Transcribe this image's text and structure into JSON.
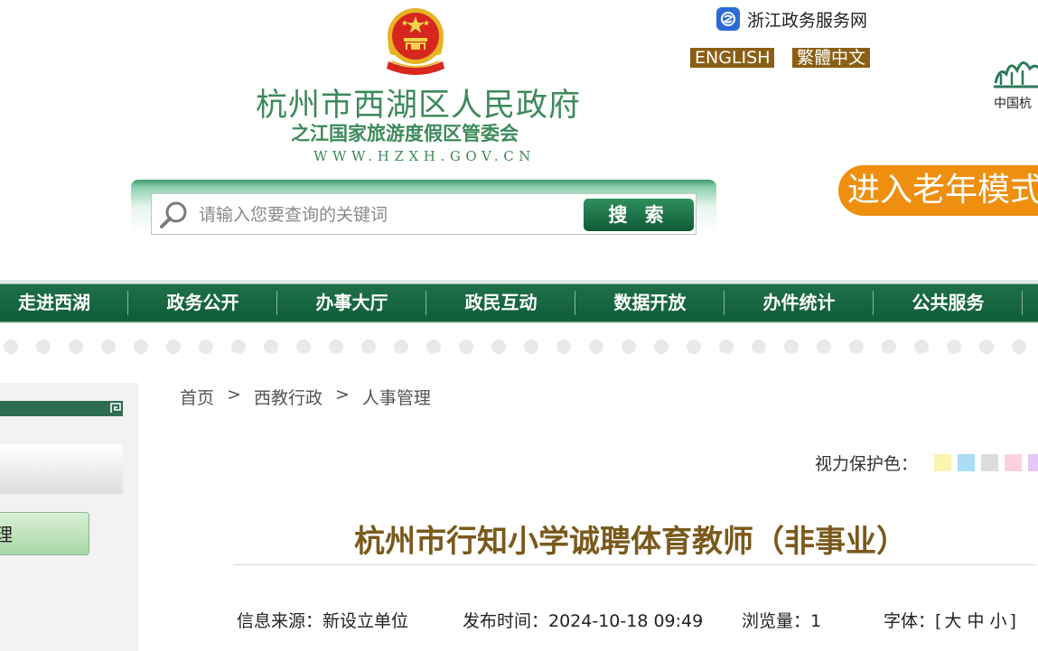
{
  "header": {
    "site_title": "杭州市西湖区人民政府",
    "site_subtitle": "之江国家旅游度假区管委会",
    "site_url": "WWW.HZXH.GOV.CN",
    "zj_service_label": "浙江政务服务网",
    "lang_english": "ENGLISH",
    "lang_traditional": "繁體中文",
    "right_logo_caption": "中国杭",
    "elder_mode_button": "进入老年模式"
  },
  "search": {
    "placeholder": "请输入您要查询的关键词",
    "button_label": "搜 索"
  },
  "nav": {
    "items": [
      {
        "label": "走进西湖"
      },
      {
        "label": "政务公开"
      },
      {
        "label": "办事大厅"
      },
      {
        "label": "政民互动"
      },
      {
        "label": "数据开放"
      },
      {
        "label": "办件统计"
      },
      {
        "label": "公共服务"
      }
    ]
  },
  "sidebar": {
    "active_item": "理"
  },
  "breadcrumb": {
    "items": [
      "首页",
      "西教行政",
      "人事管理"
    ],
    "separator": ">"
  },
  "eye_protection": {
    "label": "视力保护色：",
    "colors": [
      "#fdf4b0",
      "#a9dcf5",
      "#dcdcdc",
      "#fbd1e1",
      "#e4c8f5"
    ]
  },
  "article": {
    "title": "杭州市行知小学诚聘体育教师（非事业）",
    "source": "信息来源：新设立单位",
    "publish_time": "发布时间：2024-10-18 09:49",
    "views": "浏览量：1",
    "font_label": "字体：",
    "font_open": "[",
    "font_large": "大",
    "font_medium": "中",
    "font_small": "小",
    "font_close": "]"
  },
  "colors": {
    "brand_green": "#0f5d39",
    "title_green": "#3d8a5b",
    "title_brown": "#7a5a1c",
    "elder_orange": "#ee8f10",
    "lang_brown": "#8a5e14"
  }
}
